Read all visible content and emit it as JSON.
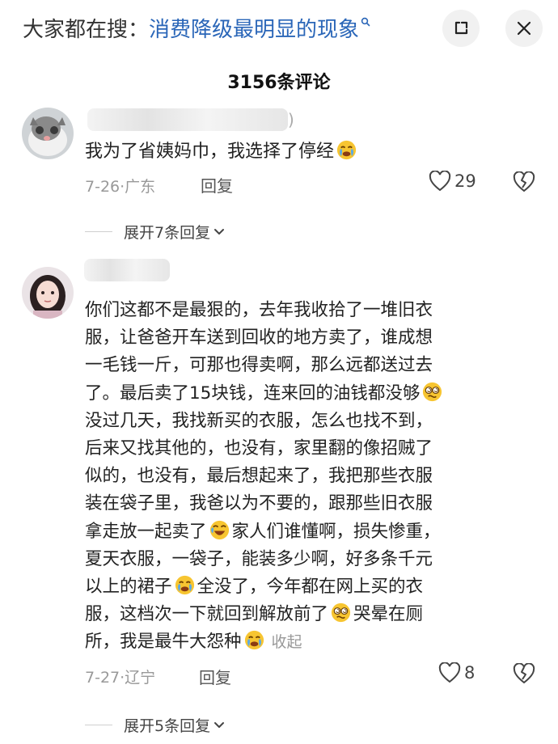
{
  "search_bar": {
    "prefix": "大家都在搜：",
    "query": "消费降级最明显的现象"
  },
  "header": {
    "comment_count": "3156条评论"
  },
  "comments": [
    {
      "text": "我为了省姨妈巾，我选择了停经",
      "date": "7-26",
      "location": "广东",
      "reply_label": "回复",
      "likes": "29",
      "expand_label": "展开7条回复"
    },
    {
      "lines": [
        "你们这都不是最狠的，去年我收拾了一堆旧衣",
        "服，让爸爸开车送到回收的地方卖了，谁成想",
        "一毛钱一斤，可那也得卖啊，那么远都送过去",
        "了。最后卖了15块钱，连来回的油钱都没够",
        "没过几天，我找新买的衣服，怎么也找不到，",
        "后来又找其他的，也没有，家里翻的像招贼了",
        "似的，也没有，最后想起来了，我把那些衣服",
        "装在袋子里，我爸以为不要的，跟那些旧衣服",
        "拿走放一起卖了",
        "家人们谁懂啊，损失惨重，",
        "夏天衣服，一袋子，能装多少啊，好多条千元",
        "以上的裙子",
        "全没了，今年都在网上买的衣",
        "服，这档次一下就回到解放前了",
        "哭晕在厕",
        "所，我是最牛大怨种",
        "收起"
      ],
      "date": "7-27",
      "location": "辽宁",
      "reply_label": "回复",
      "likes": "8",
      "expand_label": "展开5条回复"
    }
  ],
  "colors": {
    "query_blue": "#2a66b8",
    "meta_gray": "#999999",
    "emoji_yellow": "#f7c531"
  },
  "icons": [
    "search-icon",
    "expand-icon",
    "close-icon",
    "heart-icon",
    "broken-heart-icon",
    "chevron-down-icon"
  ]
}
